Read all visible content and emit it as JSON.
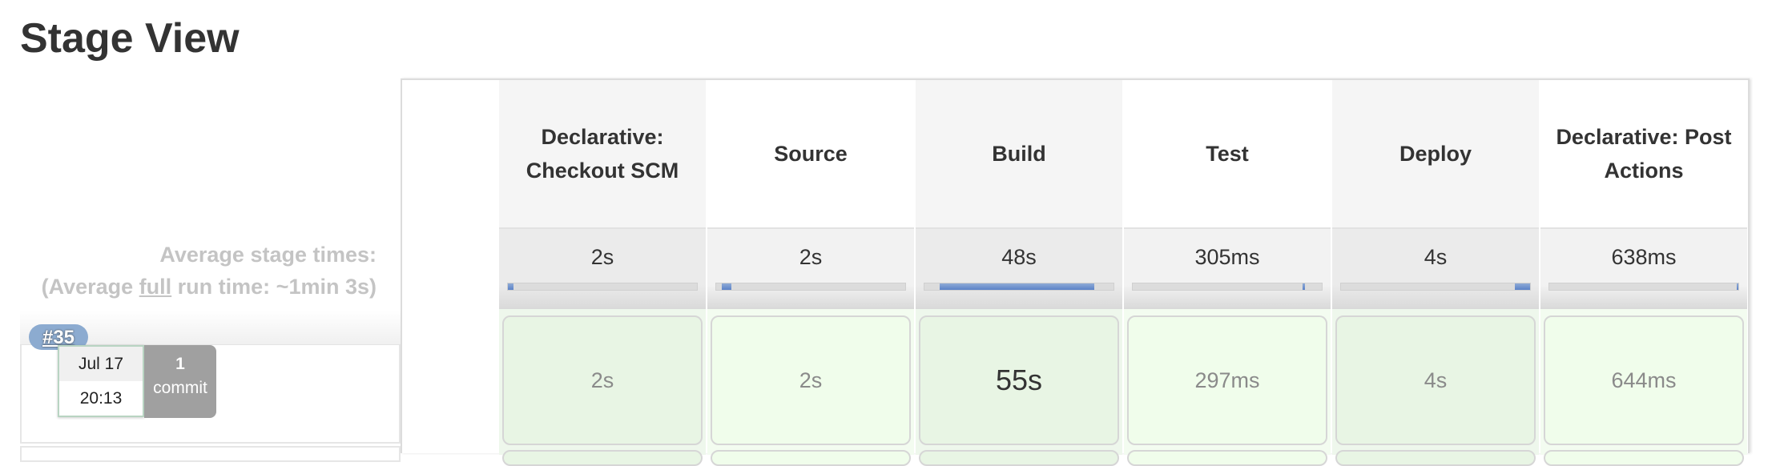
{
  "page": {
    "title": "Stage View"
  },
  "summary": {
    "avg_stage_times_label": "Average stage times:",
    "avg_full_prefix": "(Average ",
    "avg_full_link": "full",
    "avg_full_suffix": " run time: ~1min 3s)"
  },
  "stages": [
    {
      "name": "Declarative: Checkout SCM",
      "avg": "2s",
      "avg_bar": {
        "start": 0,
        "end": 3
      },
      "run": "2s"
    },
    {
      "name": "Source",
      "avg": "2s",
      "avg_bar": {
        "start": 3,
        "end": 8
      },
      "run": "2s"
    },
    {
      "name": "Build",
      "avg": "48s",
      "avg_bar": {
        "start": 8,
        "end": 90
      },
      "run": "55s"
    },
    {
      "name": "Test",
      "avg": "305ms",
      "avg_bar": {
        "start": 90,
        "end": 91
      },
      "run": "297ms"
    },
    {
      "name": "Deploy",
      "avg": "4s",
      "avg_bar": {
        "start": 92,
        "end": 100
      },
      "run": "4s"
    },
    {
      "name": "Declarative: Post Actions",
      "avg": "638ms",
      "avg_bar": {
        "start": 99,
        "end": 100
      },
      "run": "644ms"
    }
  ],
  "run": {
    "number": "#35",
    "date": "Jul 17",
    "time": "20:13",
    "commit_count": "1",
    "commit_label": "commit",
    "status_color": "#e8f5e4"
  },
  "colors": {
    "bar_fill": "#5a82c8",
    "success_bg": "#eefbe9"
  }
}
